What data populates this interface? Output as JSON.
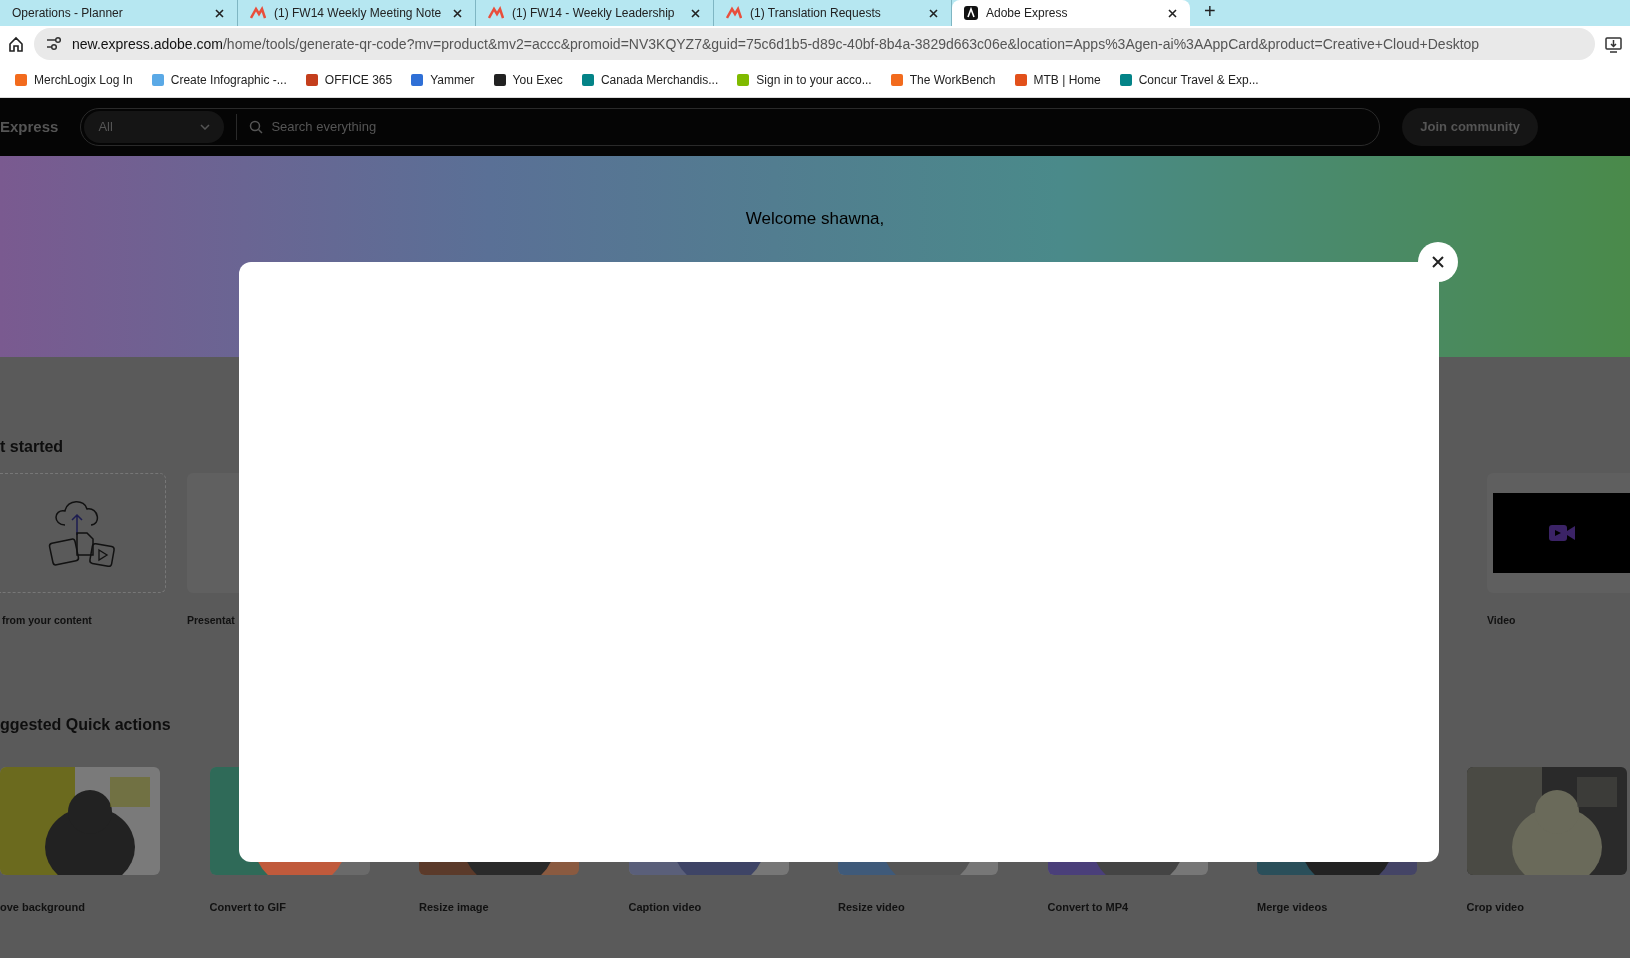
{
  "browser": {
    "tabs": [
      {
        "title": "Operations - Planner",
        "selected": false,
        "kind": "plain"
      },
      {
        "title": "(1) FW14 Weekly Meeting Note",
        "selected": false,
        "kind": "app"
      },
      {
        "title": "(1) FW14 - Weekly Leadership",
        "selected": false,
        "kind": "app"
      },
      {
        "title": "(1) Translation Requests",
        "selected": false,
        "kind": "app"
      },
      {
        "title": "Adobe Express",
        "selected": true,
        "kind": "express"
      }
    ],
    "new_tab": "+",
    "url": {
      "host": "new.express.adobe.com",
      "path": "/home/tools/generate-qr-code?mv=product&mv2=accc&promoid=NV3KQYZ7&guid=75c6d1b5-d89c-40bf-8b4a-3829d663c06e&location=Apps%3Agen-ai%3AAppCard&product=Creative+Cloud+Desktop"
    },
    "bookmarks": [
      {
        "label": "MerchLogix Log In",
        "color": "#f26b1d"
      },
      {
        "label": "Create Infographic -...",
        "color": "#5aa9e6"
      },
      {
        "label": "OFFICE 365",
        "color": "#c43e1c"
      },
      {
        "label": "Yammer",
        "color": "#2f6fd6"
      },
      {
        "label": "You Exec",
        "color": "#222222"
      },
      {
        "label": "Canada Merchandis...",
        "color": "#038387"
      },
      {
        "label": "Sign in to your acco...",
        "color": "#7fba00"
      },
      {
        "label": "The WorkBench",
        "color": "#f26b1d"
      },
      {
        "label": "MTB | Home",
        "color": "#e2501b"
      },
      {
        "label": "Concur Travel & Exp...",
        "color": "#038387"
      }
    ]
  },
  "header": {
    "logo": "Express",
    "scope": "All",
    "search_placeholder": "Search everything",
    "join": "Join community"
  },
  "hero": {
    "greeting": "Welcome shawna,"
  },
  "get_started": {
    "title": "t started",
    "items": [
      {
        "label": "from your content",
        "kind": "upload"
      },
      {
        "label": "Presentat",
        "kind": "blank"
      },
      {
        "label": "Video",
        "kind": "video"
      }
    ]
  },
  "quick_actions": {
    "title": "ggested Quick actions",
    "items": [
      {
        "label": "ove background"
      },
      {
        "label": "Convert to GIF"
      },
      {
        "label": "Resize image"
      },
      {
        "label": "Caption video"
      },
      {
        "label": "Resize video"
      },
      {
        "label": "Convert to MP4"
      },
      {
        "label": "Merge videos"
      },
      {
        "label": "Crop video"
      }
    ]
  },
  "dialog": {
    "open": true
  }
}
